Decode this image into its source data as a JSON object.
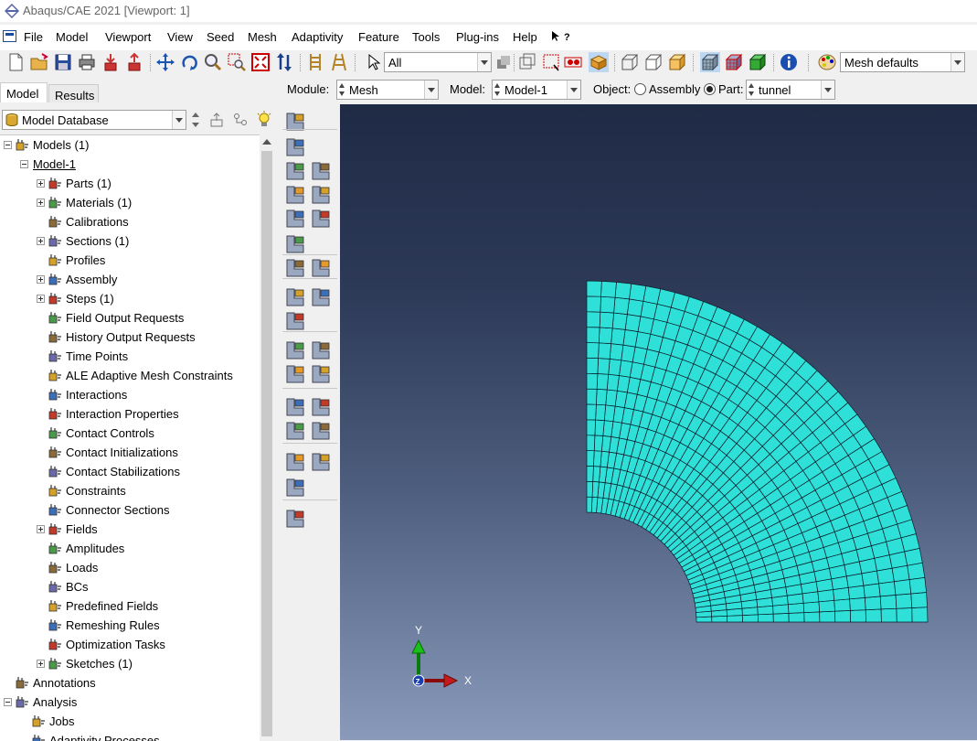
{
  "window": {
    "title": "Abaqus/CAE 2021 [Viewport: 1]"
  },
  "menu": [
    "File",
    "Model",
    "Viewport",
    "View",
    "Seed",
    "Mesh",
    "Adaptivity",
    "Feature",
    "Tools",
    "Plug-ins",
    "Help",
    "?"
  ],
  "toolbar": {
    "selection_filter": "All",
    "mesh_defaults": "Mesh defaults"
  },
  "context": {
    "module_label": "Module:",
    "module_value": "Mesh",
    "model_label": "Model:",
    "model_value": "Model-1",
    "object_label": "Object:",
    "assembly_label": "Assembly",
    "part_label": "Part:",
    "part_value": "tunnel",
    "object_selected": "Part"
  },
  "tabs": {
    "model": "Model",
    "results": "Results",
    "active": "Model"
  },
  "tree_header": {
    "database": "Model Database"
  },
  "tree": [
    {
      "label": "Models (1)",
      "indent": 0,
      "expander": "minus",
      "icon": "models-icon"
    },
    {
      "label": "Model-1",
      "indent": 1,
      "expander": "minus",
      "icon": "",
      "underline": true
    },
    {
      "label": "Parts (1)",
      "indent": 2,
      "expander": "plus",
      "icon": "parts-icon"
    },
    {
      "label": "Materials (1)",
      "indent": 2,
      "expander": "plus",
      "icon": "materials-icon"
    },
    {
      "label": "Calibrations",
      "indent": 2,
      "expander": "",
      "icon": "calibrations-icon"
    },
    {
      "label": "Sections (1)",
      "indent": 2,
      "expander": "plus",
      "icon": "sections-icon"
    },
    {
      "label": "Profiles",
      "indent": 2,
      "expander": "",
      "icon": "profiles-icon"
    },
    {
      "label": "Assembly",
      "indent": 2,
      "expander": "plus",
      "icon": "assembly-icon"
    },
    {
      "label": "Steps (1)",
      "indent": 2,
      "expander": "plus",
      "icon": "steps-icon"
    },
    {
      "label": "Field Output Requests",
      "indent": 2,
      "expander": "",
      "icon": "field-output-icon"
    },
    {
      "label": "History Output Requests",
      "indent": 2,
      "expander": "",
      "icon": "history-output-icon"
    },
    {
      "label": "Time Points",
      "indent": 2,
      "expander": "",
      "icon": "time-points-icon"
    },
    {
      "label": "ALE Adaptive Mesh Constraints",
      "indent": 2,
      "expander": "",
      "icon": "ale-icon"
    },
    {
      "label": "Interactions",
      "indent": 2,
      "expander": "",
      "icon": "interactions-icon"
    },
    {
      "label": "Interaction Properties",
      "indent": 2,
      "expander": "",
      "icon": "interaction-properties-icon"
    },
    {
      "label": "Contact Controls",
      "indent": 2,
      "expander": "",
      "icon": "contact-controls-icon"
    },
    {
      "label": "Contact Initializations",
      "indent": 2,
      "expander": "",
      "icon": "contact-initializations-icon"
    },
    {
      "label": "Contact Stabilizations",
      "indent": 2,
      "expander": "",
      "icon": "contact-stabilizations-icon"
    },
    {
      "label": "Constraints",
      "indent": 2,
      "expander": "",
      "icon": "constraints-icon"
    },
    {
      "label": "Connector Sections",
      "indent": 2,
      "expander": "",
      "icon": "connector-sections-icon"
    },
    {
      "label": "Fields",
      "indent": 2,
      "expander": "plus",
      "icon": "fields-icon"
    },
    {
      "label": "Amplitudes",
      "indent": 2,
      "expander": "",
      "icon": "amplitudes-icon"
    },
    {
      "label": "Loads",
      "indent": 2,
      "expander": "",
      "icon": "loads-icon"
    },
    {
      "label": "BCs",
      "indent": 2,
      "expander": "",
      "icon": "bcs-icon"
    },
    {
      "label": "Predefined Fields",
      "indent": 2,
      "expander": "",
      "icon": "predefined-fields-icon"
    },
    {
      "label": "Remeshing Rules",
      "indent": 2,
      "expander": "",
      "icon": "remeshing-rules-icon"
    },
    {
      "label": "Optimization Tasks",
      "indent": 2,
      "expander": "",
      "icon": "optimization-tasks-icon"
    },
    {
      "label": "Sketches (1)",
      "indent": 2,
      "expander": "plus",
      "icon": "sketches-icon"
    },
    {
      "label": "Annotations",
      "indent": 0,
      "expander": "",
      "icon": "annotations-icon"
    },
    {
      "label": "Analysis",
      "indent": 0,
      "expander": "minus",
      "icon": "analysis-icon"
    },
    {
      "label": "Jobs",
      "indent": 1,
      "expander": "",
      "icon": "jobs-icon"
    },
    {
      "label": "Adaptivity Processes",
      "indent": 1,
      "expander": "",
      "icon": "adaptivity-processes-icon"
    }
  ],
  "triad": {
    "y_label": "Y",
    "x_label": "X",
    "z_label": "Z"
  },
  "mesh": {
    "radial_elements": 15,
    "circumferential_elements": 36,
    "color": "#2fe0d8",
    "edge_color": "#0a1a28"
  },
  "colors": {
    "viewport_top": "#1f2a45",
    "viewport_bottom": "#8a9abb",
    "selected_tool": "#bcd7f2"
  }
}
